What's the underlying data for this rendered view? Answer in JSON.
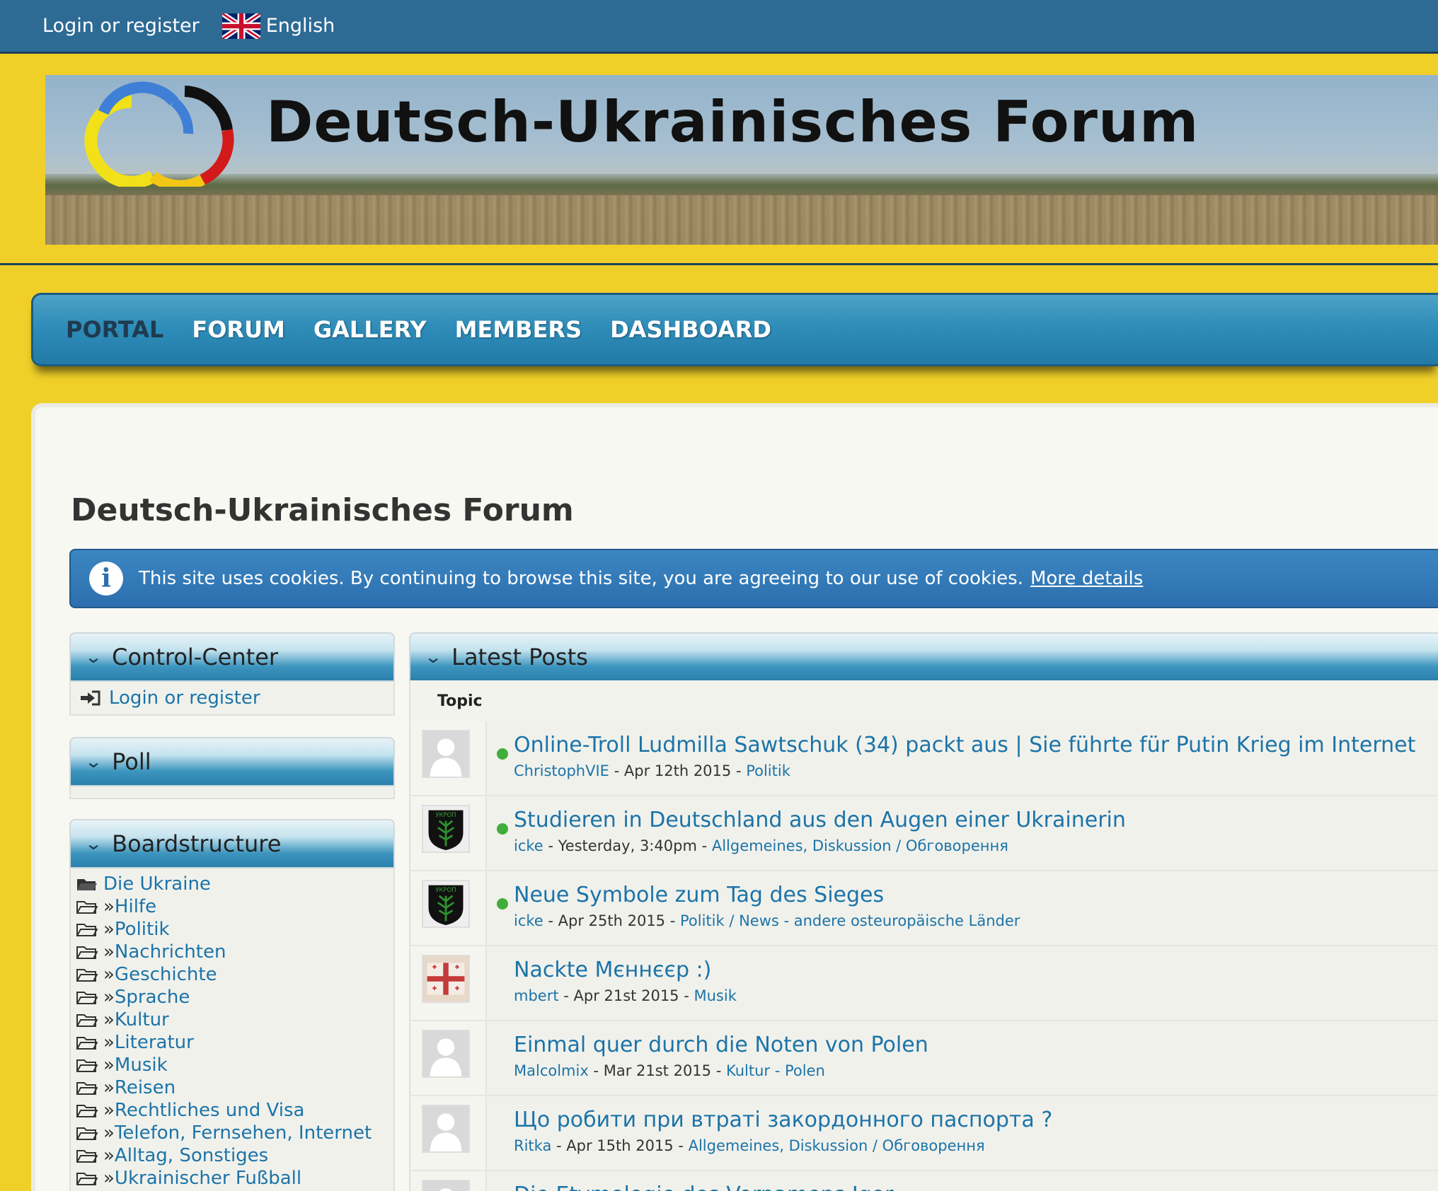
{
  "topbar": {
    "login": "Login or register",
    "language": "English"
  },
  "banner": {
    "title": "Deutsch-Ukrainisches Forum"
  },
  "nav": {
    "items": [
      "PORTAL",
      "FORUM",
      "GALLERY",
      "MEMBERS",
      "DASHBOARD"
    ],
    "active": "PORTAL"
  },
  "page": {
    "title": "Deutsch-Ukrainisches Forum"
  },
  "cookie_notice": {
    "text": "This site uses cookies. By continuing to browse this site, you are agreeing to our use of cookies.",
    "link": "More details"
  },
  "sidebar": {
    "control_center": {
      "title": "Control-Center",
      "login": "Login or register"
    },
    "poll": {
      "title": "Poll"
    },
    "boardstructure": {
      "title": "Boardstructure",
      "items": [
        {
          "prefix": "",
          "label": "Die Ukraine",
          "open": true
        },
        {
          "prefix": "»",
          "label": "Hilfe"
        },
        {
          "prefix": "»",
          "label": "Politik"
        },
        {
          "prefix": "»",
          "label": "Nachrichten"
        },
        {
          "prefix": "»",
          "label": "Geschichte"
        },
        {
          "prefix": "»",
          "label": "Sprache"
        },
        {
          "prefix": "»",
          "label": "Kultur"
        },
        {
          "prefix": "»",
          "label": "Literatur"
        },
        {
          "prefix": "»",
          "label": "Musik"
        },
        {
          "prefix": "»",
          "label": "Reisen"
        },
        {
          "prefix": "»",
          "label": "Rechtliches und Visa"
        },
        {
          "prefix": "»",
          "label": "Telefon, Fernsehen, Internet"
        },
        {
          "prefix": "»",
          "label": "Alltag, Sonstiges"
        },
        {
          "prefix": "»",
          "label": "Ukrainischer Fußball"
        }
      ]
    }
  },
  "latest_posts": {
    "title": "Latest Posts",
    "column": "Topic",
    "posts": [
      {
        "title": "Online-Troll Ludmilla Sawtschuk (34) packt aus | Sie führte für Putin Krieg im Internet",
        "author": "ChristophVIE",
        "date": "Apr 12th 2015",
        "category": "Politik",
        "unread": true,
        "avatar": "default"
      },
      {
        "title": "Studieren in Deutschland aus den Augen einer Ukrainerin",
        "author": "icke",
        "date": "Yesterday, 3:40pm",
        "category": "Allgemeines, Diskussion / Обговорення",
        "unread": true,
        "avatar": "ukrop"
      },
      {
        "title": "Neue Symbole zum Tag des Sieges",
        "author": "icke",
        "date": "Apr 25th 2015",
        "category": "Politik / News - andere osteuropäische Länder",
        "unread": true,
        "avatar": "ukrop"
      },
      {
        "title": "Nackte Мєннєєр :)",
        "author": "mbert",
        "date": "Apr 21st 2015",
        "category": "Musik",
        "unread": false,
        "avatar": "flag"
      },
      {
        "title": "Einmal quer durch die Noten von Polen",
        "author": "Malcolmix",
        "date": "Mar 21st 2015",
        "category": "Kultur - Polen",
        "unread": false,
        "avatar": "default"
      },
      {
        "title": "Що робити при втраті закордонного паспорта ?",
        "author": "Ritka",
        "date": "Apr 15th 2015",
        "category": "Allgemeines, Diskussion / Обговорення",
        "unread": false,
        "avatar": "default"
      },
      {
        "title": "Die Etymologie des Vornamens Igor",
        "author": "",
        "date": "",
        "category": "",
        "unread": false,
        "avatar": "default"
      }
    ]
  },
  "colors": {
    "topbar": "#2d6a94",
    "page_bg": "#f0d028",
    "nav": "#2f8db9",
    "link": "#1b74a8",
    "online_dot": "#3fae3a"
  }
}
